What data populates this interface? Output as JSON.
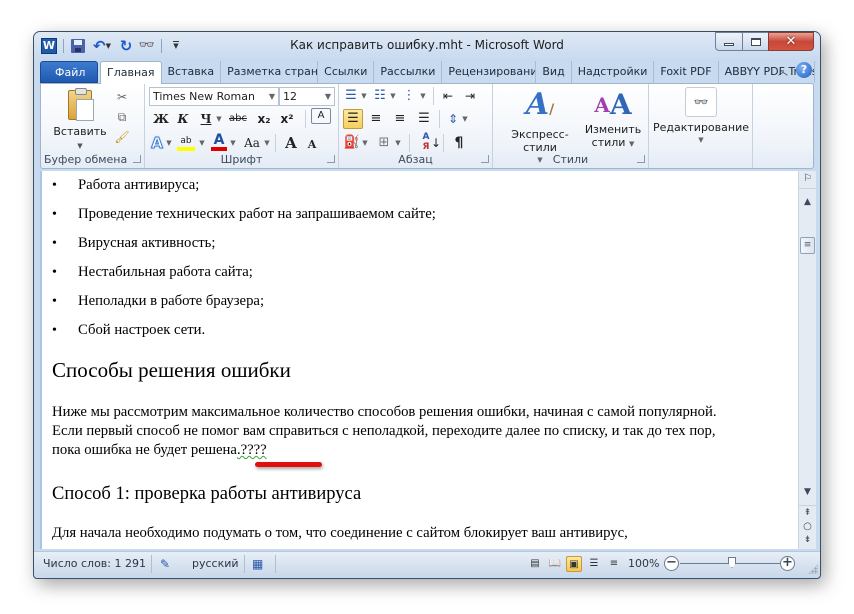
{
  "window": {
    "title": "Как исправить ошибку.mht  -  Microsoft Word",
    "controls": {
      "minimize": "minimize",
      "maximize": "maximize",
      "close": "✕"
    }
  },
  "quick_access": {
    "app_icon": "W",
    "items": [
      "save-icon",
      "undo-icon",
      "redo-icon",
      "find-icon",
      "customize-icon"
    ]
  },
  "tabs": [
    {
      "label": "Файл",
      "kind": "file"
    },
    {
      "label": "Главная",
      "active": true
    },
    {
      "label": "Вставка"
    },
    {
      "label": "Разметка страні"
    },
    {
      "label": "Ссылки"
    },
    {
      "label": "Рассылки"
    },
    {
      "label": "Рецензировани"
    },
    {
      "label": "Вид"
    },
    {
      "label": "Надстройки"
    },
    {
      "label": "Foxit PDF"
    },
    {
      "label": "ABBYY PDF Trans"
    }
  ],
  "ribbon": {
    "clipboard": {
      "label": "Буфер обмена",
      "paste": "Вставить"
    },
    "font": {
      "label": "Шрифт",
      "font_name": "Times New Roman",
      "font_size": "12",
      "bold": "Ж",
      "italic": "К",
      "underline": "Ч",
      "strike": "abc",
      "subscript": "x₂",
      "superscript": "x²",
      "grow": "A",
      "shrink": "A",
      "case": "Aa",
      "highlight_color": "#ffff00",
      "font_color": "#e00000"
    },
    "paragraph": {
      "label": "Абзац",
      "pilcrow": "¶"
    },
    "styles": {
      "label": "Стили",
      "express": "Экспресс-стили",
      "change_line1": "Изменить",
      "change_line2": "стили"
    },
    "editing": {
      "label": "Редактирование"
    }
  },
  "document": {
    "bullets": [
      "Работа антивируса;",
      "Проведение технических работ на запрашиваемом сайте;",
      "Вирусная активность;",
      "Нестабильная работа сайта;",
      "Неполадки в работе браузера;",
      "Сбой настроек сети."
    ],
    "heading": "Способы решения ошибки",
    "paragraph_lines": [
      "Ниже мы рассмотрим максимальное количество способов решения ошибки, начиная с самой популярной.",
      "Если первый способ не помог вам справиться с неполадкой, переходите далее по списку, и так до тех пор,",
      "пока ошибка не будет решена"
    ],
    "paragraph_tail": ".????",
    "subheading": "Способ 1: проверка работы антивируса",
    "paragraph2": "Для начала необходимо подумать о том, что соединение с сайтом блокирует ваш антивирус,"
  },
  "statusbar": {
    "word_count": "Число слов: 1 291",
    "language": "русский",
    "zoom_level": "100%",
    "zoom_percent": 100
  }
}
